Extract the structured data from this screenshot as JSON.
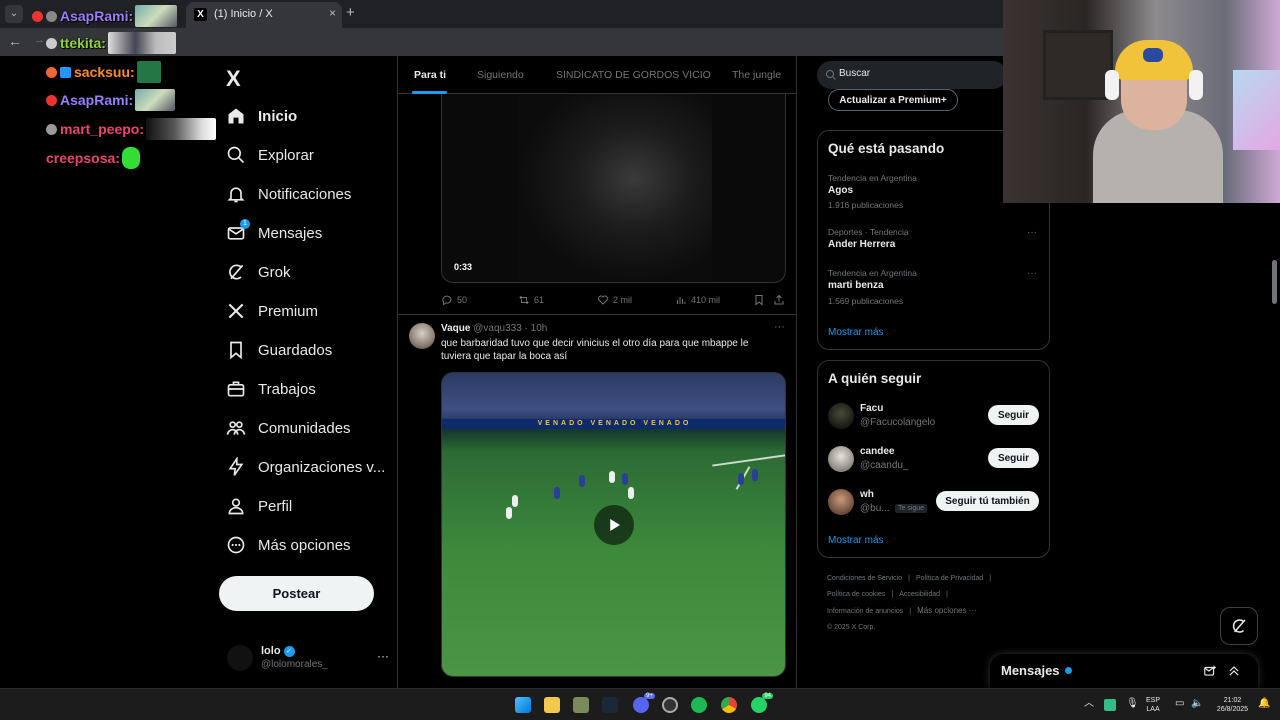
{
  "browser": {
    "tab_title": "(1) Inicio / X",
    "tab_new": "+",
    "tab_close": "×"
  },
  "chat": {
    "lines": [
      {
        "user": "AsapRami:",
        "color": "#9c7cff"
      },
      {
        "user": "ttekita:",
        "color": "#8bd63f"
      },
      {
        "user": "sacksuu:",
        "color": "#ff8a2e"
      },
      {
        "user": "AsapRami:",
        "color": "#9c7cff"
      },
      {
        "user": "mart_peepo:",
        "color": "#e8466b"
      },
      {
        "user": "creepsosa:",
        "color": "#e8466b"
      }
    ]
  },
  "nav": {
    "logo": "X",
    "items": [
      {
        "label": "Inicio",
        "icon": "home-icon"
      },
      {
        "label": "Explorar",
        "icon": "search-icon"
      },
      {
        "label": "Notificaciones",
        "icon": "bell-icon"
      },
      {
        "label": "Mensajes",
        "icon": "mail-icon",
        "badge": "1"
      },
      {
        "label": "Grok",
        "icon": "grok-icon"
      },
      {
        "label": "Premium",
        "icon": "x-logo-icon"
      },
      {
        "label": "Guardados",
        "icon": "bookmark-icon"
      },
      {
        "label": "Trabajos",
        "icon": "briefcase-icon"
      },
      {
        "label": "Comunidades",
        "icon": "people-icon"
      },
      {
        "label": "Organizaciones v...",
        "icon": "lightning-icon"
      },
      {
        "label": "Perfil",
        "icon": "person-icon"
      },
      {
        "label": "Más opciones",
        "icon": "more-circle-icon"
      }
    ],
    "post_button": "Postear",
    "account": {
      "name": "lolo",
      "handle": "@lolomorales_",
      "more": "···"
    }
  },
  "feed": {
    "tabs": [
      "Para ti",
      "Siguiendo",
      "SINDICATO DE GORDOS VICIO",
      "The jungle"
    ],
    "post1": {
      "video_time": "0:33",
      "replies": "50",
      "reposts": "61",
      "likes": "2 mil",
      "views": "410 mil"
    },
    "post2": {
      "name": "Vaque",
      "handle": "@vaqu333",
      "time": "· 10h",
      "more": "···",
      "text": "que barbaridad tuvo que decir vinicius el otro día para que mbappe le tuviera que tapar la boca así",
      "board_text": "VENADO    VENADO    VENADO"
    }
  },
  "sidebar": {
    "search_placeholder": "Buscar",
    "premium_button": "Actualizar a Premium+",
    "trends_title": "Qué está pasando",
    "trends": [
      {
        "context": "Tendencia en Argentina",
        "name": "Agos",
        "count": "1.916 publicaciones"
      },
      {
        "context": "Deportes · Tendencia",
        "name": "Ander Herrera",
        "count": ""
      },
      {
        "context": "Tendencia en Argentina",
        "name": "marti benza",
        "count": "1.569 publicaciones"
      }
    ],
    "trend_more": "···",
    "show_more": "Mostrar más",
    "follow_title": "A quién seguir",
    "follow": [
      {
        "name": "Facu",
        "handle": "@Facucolangelo",
        "button": "Seguir",
        "follows_you": ""
      },
      {
        "name": "candee",
        "handle": "@caandu_",
        "button": "Seguir",
        "follows_you": ""
      },
      {
        "name": "wh",
        "handle": "@bu...",
        "button": "Seguir tú también",
        "follows_you": "Te sigue"
      }
    ],
    "follow_show_more": "Mostrar más",
    "footer": {
      "terms": "Condiciones de Servicio",
      "privacy": "Política de Privacidad",
      "cookies": "Política de cookies",
      "accessibility": "Accesibilidad",
      "ads": "Información de anuncios",
      "more": "Más opciones ···",
      "copyright": "© 2025 X Corp."
    }
  },
  "messages": {
    "title": "Mensajes"
  },
  "taskbar": {
    "lang": "ESP",
    "lang2": "LAA",
    "time": "21:02",
    "date": "26/8/2025",
    "discord_badge": "9+",
    "whatsapp_badge": "94"
  }
}
